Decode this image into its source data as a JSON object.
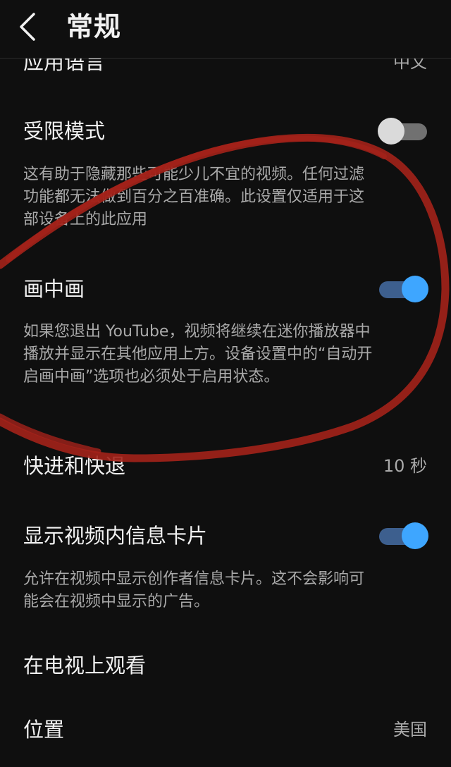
{
  "header": {
    "title": "常规"
  },
  "settings": {
    "app_language": {
      "title": "应用语言",
      "value": "中文"
    },
    "restricted_mode": {
      "title": "受限模式",
      "enabled": false,
      "description": "这有助于隐藏那些可能少儿不宜的视频。任何过滤功能都无法做到百分之百准确。此设置仅适用于这部设备上的此应用"
    },
    "picture_in_picture": {
      "title": "画中画",
      "enabled": true,
      "description": "如果您退出 YouTube，视频将继续在迷你播放器中播放并显示在其他应用上方。设备设置中的“自动开启画中画”选项也必须处于启用状态。"
    },
    "seek": {
      "title": "快进和快退",
      "value": "10 秒"
    },
    "info_cards": {
      "title": "显示视频内信息卡片",
      "enabled": true,
      "description": "允许在视频中显示创作者信息卡片。这不会影响可能会在视频中显示的广告。"
    },
    "watch_on_tv": {
      "title": "在电视上观看"
    },
    "location": {
      "title": "位置",
      "value": "美国"
    }
  },
  "annotation": {
    "color": "#a3221a"
  },
  "theme": {
    "background": "#0f0f0f",
    "toggle_on": "#3ea6ff",
    "toggle_off": "#dadada"
  }
}
